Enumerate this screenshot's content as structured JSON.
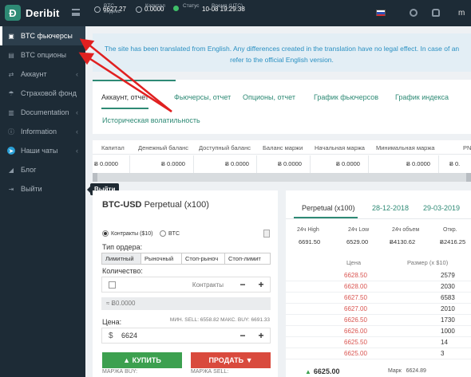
{
  "header": {
    "logo_text": "Deribit",
    "stats": [
      {
        "label": "BTC индекс",
        "value": "6627.27"
      },
      {
        "label": "Капитал",
        "value": "0.0000"
      },
      {
        "label": "Статус",
        "value": ""
      },
      {
        "label": "Время (UTC)",
        "value": "10-08 19:29:38"
      }
    ],
    "user_initial": "m"
  },
  "sidebar": {
    "items": [
      {
        "label": "BTC фьючерсы",
        "icon": "futures-icon"
      },
      {
        "label": "BTC опционы",
        "icon": "options-icon"
      },
      {
        "label": "Аккаунт",
        "icon": "account-icon"
      },
      {
        "label": "Страховой фонд",
        "icon": "insurance-icon"
      },
      {
        "label": "Documentation",
        "icon": "book-icon"
      },
      {
        "label": "Information",
        "icon": "info-icon"
      },
      {
        "label": "Наши чаты",
        "icon": "telegram-icon"
      },
      {
        "label": "Блог",
        "icon": "rss-icon"
      },
      {
        "label": "Выйти",
        "icon": "logout-icon"
      }
    ],
    "tooltip": "Выйти"
  },
  "notice": {
    "line1": "The site has been translated from English. Any differences created in the translation have no legal effect. In case of an",
    "line2": "refer to the official English version."
  },
  "tabs": [
    "Аккаунт, отчет",
    "Фьючерсы, отчет",
    "Опционы, отчет",
    "График фьючерсов",
    "График индекса",
    "Историческая волатильность"
  ],
  "account_table": {
    "headers": [
      "Капитал",
      "Денежный баланс",
      "Доступный баланс",
      "Баланс маржи",
      "Начальная маржа",
      "Минимальная маржа",
      "PN"
    ],
    "values": [
      "0.0000",
      "0.0000",
      "0.0000",
      "0.0000",
      "0.0000",
      "0.0000",
      "0."
    ]
  },
  "order_form": {
    "title_bold": "BTC-USD",
    "title_rest": "Perpetual (x100)",
    "radio_contracts": "Контракты ($10)",
    "radio_btc": "BTC",
    "order_type_label": "Тип ордера:",
    "order_types": [
      "Лимитный",
      "Рыночный",
      "Стоп-рыноч",
      "Стоп-лимит"
    ],
    "quantity_label": "Количество:",
    "quantity_placeholder": "Контракты",
    "btc_value": "≈ Ƀ0.0000",
    "price_label": "Цена:",
    "price_minmax": "МИН. SELL:  6558.82  МАКС. BUY:  6691.33",
    "currency": "$",
    "price_value": "6624",
    "buy_label": "КУПИТЬ",
    "sell_label": "ПРОДАТЬ",
    "margin_buy": "МАРЖА BUY:",
    "margin_sell": "МАРЖА SELL:"
  },
  "orderbook": {
    "tabs": [
      "Perpetual (x100)",
      "28-12-2018",
      "29-03-2019"
    ],
    "stats": [
      {
        "label": "24ч High",
        "value": "6691.50"
      },
      {
        "label": "24ч Low",
        "value": "6529.00"
      },
      {
        "label": "24ч объем",
        "value": "4130.62"
      },
      {
        "label": "Откр.",
        "value": "2416.25"
      }
    ],
    "col_price": "Цена",
    "col_size": "Размер (x $10)",
    "rows": [
      {
        "price": "6628.50",
        "size": "2579"
      },
      {
        "price": "6628.00",
        "size": "2030"
      },
      {
        "price": "6627.50",
        "size": "6583"
      },
      {
        "price": "6627.00",
        "size": "2010"
      },
      {
        "price": "6626.50",
        "size": "1730"
      },
      {
        "price": "6626.00",
        "size": "1000"
      },
      {
        "price": "6625.50",
        "size": "14"
      },
      {
        "price": "6625.00",
        "size": "3"
      }
    ],
    "last_price": "6625.00",
    "mark_label": "Марк",
    "mark_price": "6624.89"
  }
}
